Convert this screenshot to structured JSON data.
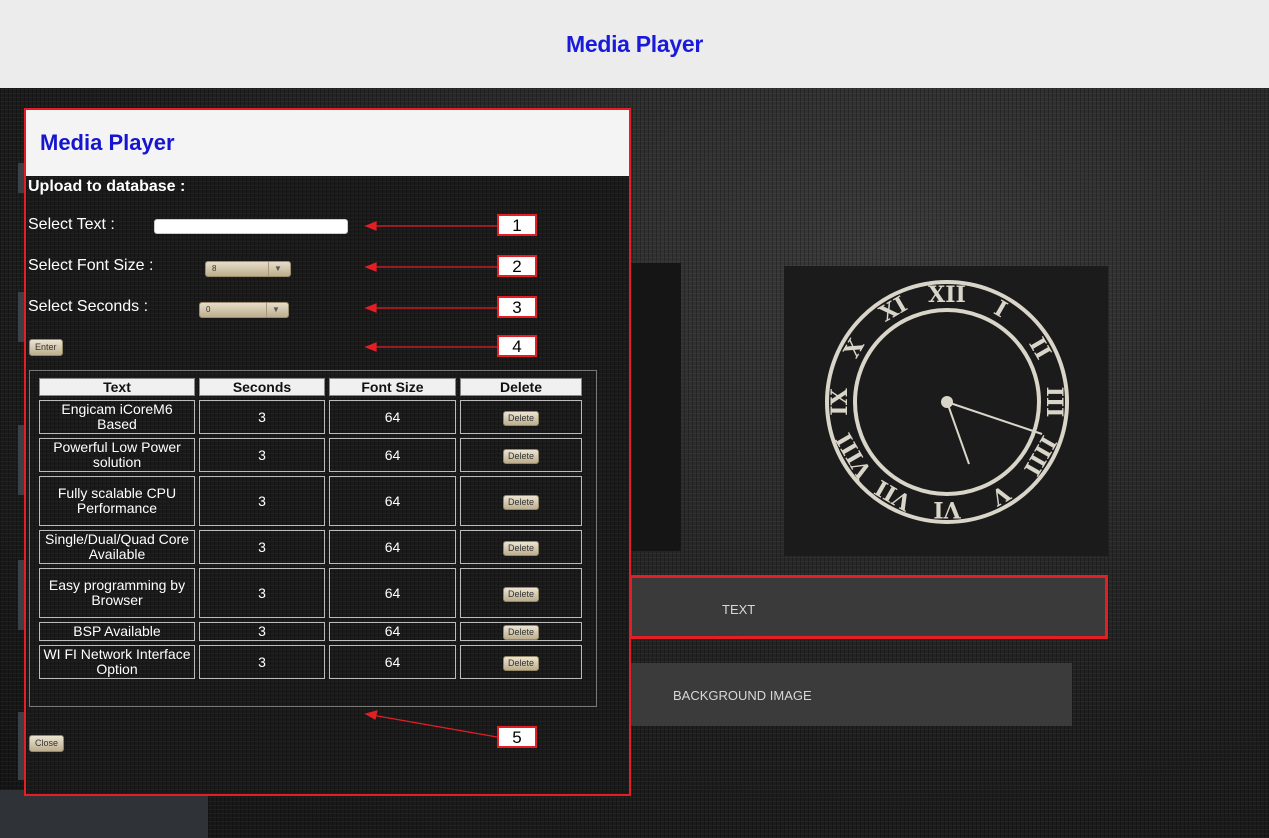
{
  "header": {
    "title": "Media Player"
  },
  "dialog": {
    "title": "Media Player",
    "upload_label": "Upload to database :",
    "select_text_label": "Select Text :",
    "text_input_value": "",
    "font_size_label": "Select Font Size :",
    "font_size_value": "8",
    "seconds_label": "Select Seconds :",
    "seconds_value": "0",
    "enter_button": "Enter",
    "close_button": "Close",
    "table": {
      "headers": [
        "Text",
        "Seconds",
        "Font Size",
        "Delete"
      ],
      "rows": [
        {
          "text": "Engicam iCoreM6 Based",
          "seconds": "3",
          "font_size": "64",
          "delete": "Delete"
        },
        {
          "text": "Powerful Low Power solution",
          "seconds": "3",
          "font_size": "64",
          "delete": "Delete"
        },
        {
          "text": "Fully scalable CPU Performance",
          "seconds": "3",
          "font_size": "64",
          "delete": "Delete"
        },
        {
          "text": "Single/Dual/Quad Core Available",
          "seconds": "3",
          "font_size": "64",
          "delete": "Delete"
        },
        {
          "text": "Easy programming by Browser",
          "seconds": "3",
          "font_size": "64",
          "delete": "Delete"
        },
        {
          "text": "BSP Available",
          "seconds": "3",
          "font_size": "64",
          "delete": "Delete"
        },
        {
          "text": "WI FI Network Interface Option",
          "seconds": "3",
          "font_size": "64",
          "delete": "Delete"
        }
      ]
    }
  },
  "annotations": [
    "1",
    "2",
    "3",
    "4",
    "5"
  ],
  "clock": {
    "numerals": [
      "XII",
      "I",
      "II",
      "III",
      "IIII",
      "V",
      "VI",
      "VII",
      "VIII",
      "IX",
      "X",
      "XI"
    ]
  },
  "text_bar": {
    "label": "TEXT"
  },
  "background_bar": {
    "label": "BACKGROUND IMAGE"
  },
  "colors": {
    "accent_red": "#e31f25",
    "title_blue": "#1a1adb",
    "header_bg": "#ececec"
  }
}
